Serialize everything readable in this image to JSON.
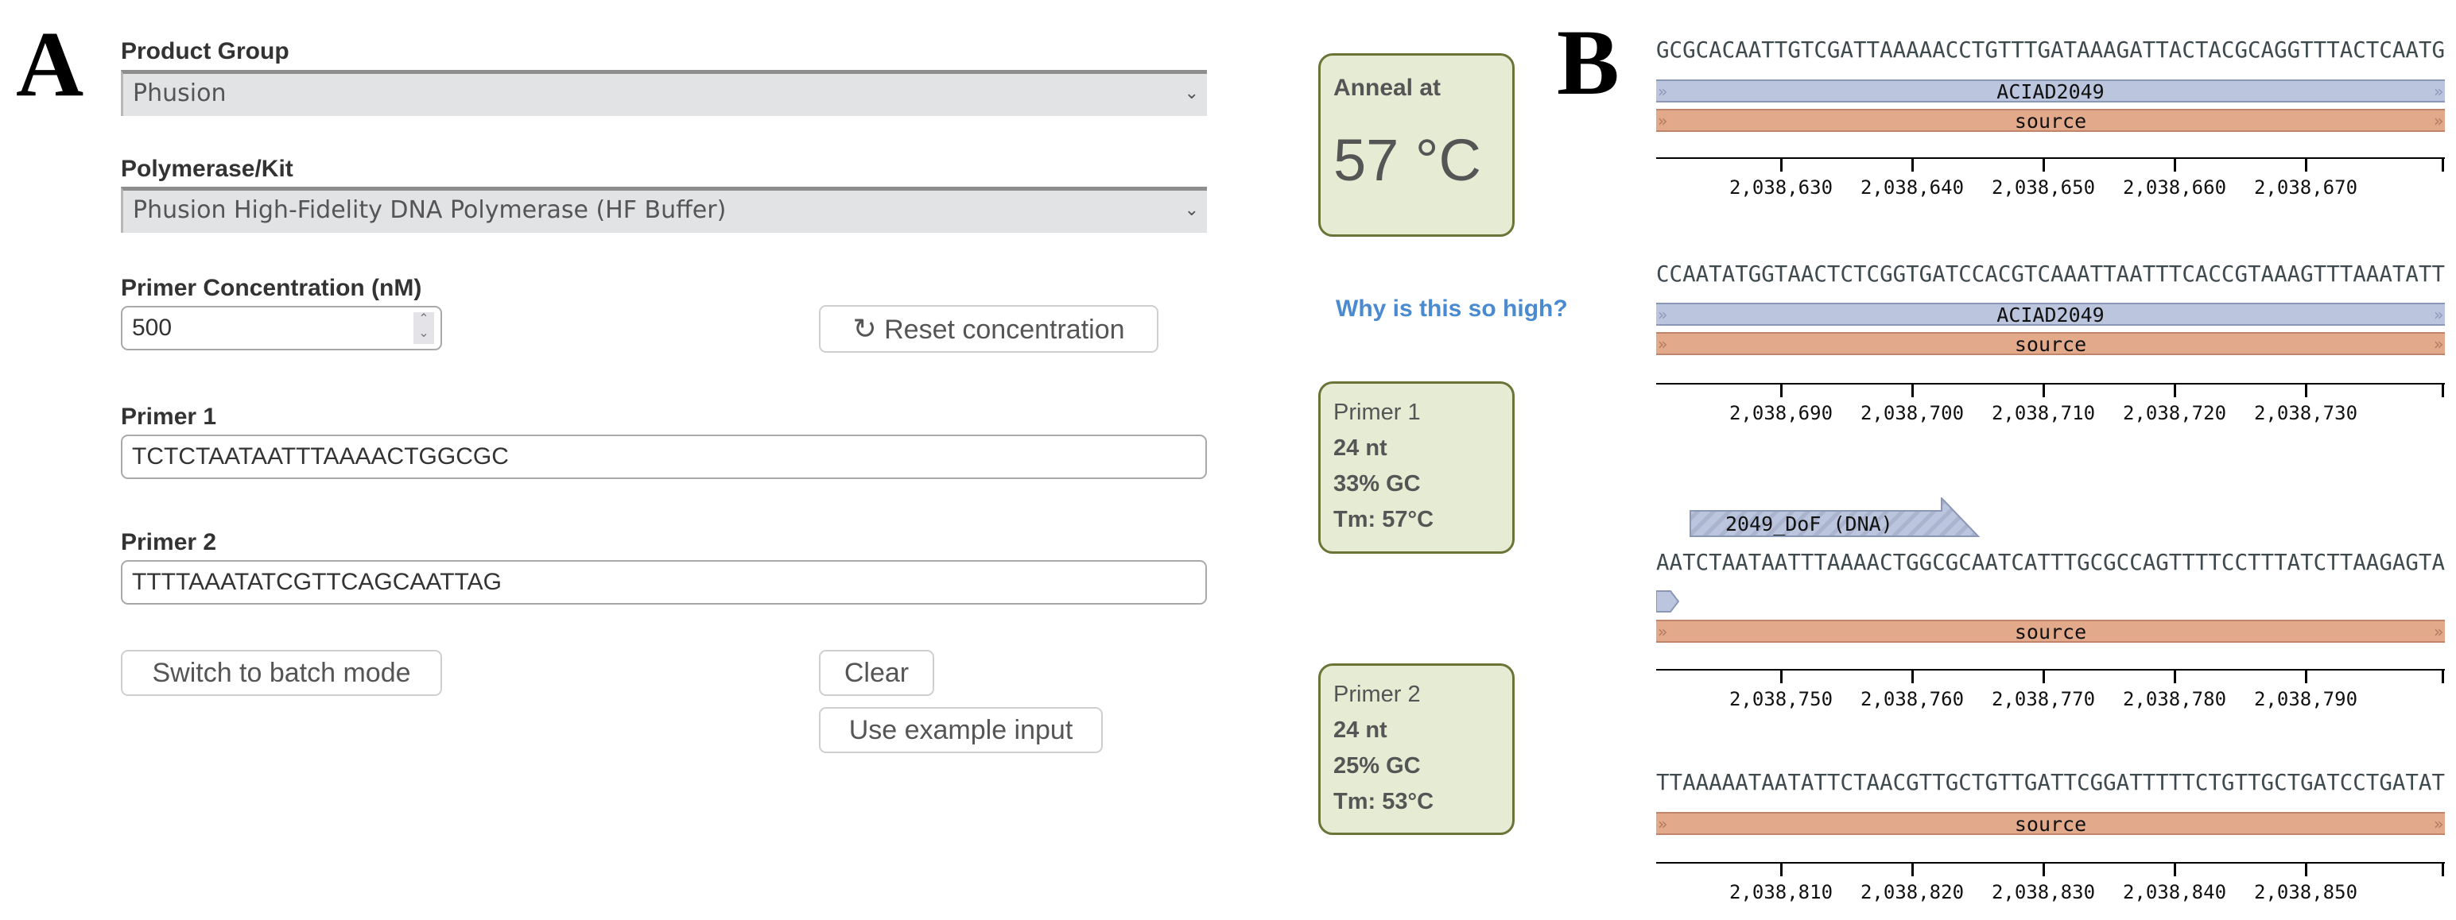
{
  "panel_a": {
    "letter": "A",
    "product_group": {
      "label": "Product Group",
      "value": "Phusion"
    },
    "polymerase": {
      "label": "Polymerase/Kit",
      "value": "Phusion High-Fidelity DNA Polymerase (HF Buffer)"
    },
    "primer_concentration": {
      "label": "Primer Concentration (nM)",
      "value": "500"
    },
    "reset_button": "Reset concentration",
    "primer1": {
      "label": "Primer 1",
      "value": "TCTCTAATAATTTAAAACTGGCGC"
    },
    "primer2": {
      "label": "Primer 2",
      "value": "TTTTAAATATCGTTCAGCAATTAG"
    },
    "batch_button": "Switch to batch mode",
    "clear_button": "Clear",
    "example_button": "Use example input",
    "anneal": {
      "title": "Anneal at",
      "value": "57 °C"
    },
    "why_link": "Why is this so high?",
    "primer1_result": {
      "title": "Primer 1",
      "length": "24 nt",
      "gc": "33% GC",
      "tm": "Tm: 57°C"
    },
    "primer2_result": {
      "title": "Primer 2",
      "length": "24 nt",
      "gc": "25% GC",
      "tm": "Tm: 53°C"
    },
    "colors": {
      "card_bg": "#e6ebd4",
      "card_border": "#6b7436",
      "link": "#4a8ad0"
    }
  },
  "panel_b": {
    "letter": "B",
    "rows": [
      {
        "sequence": "GCGCACAATTGTCGATTAAAAACCTGTTTGATAAAGATTACTACGCAGGTTTACTCAATG",
        "features": [
          {
            "type": "gene",
            "label": "ACIAD2049"
          },
          {
            "type": "source",
            "label": "source"
          }
        ],
        "ticks": [
          "2,038,630",
          "2,038,640",
          "2,038,650",
          "2,038,660",
          "2,038,670"
        ]
      },
      {
        "sequence": "CCAATATGGTAACTCTCGGTGATCCACGTCAAATTAATTTCACCGTAAAGTTTAAATATT",
        "features": [
          {
            "type": "gene",
            "label": "ACIAD2049"
          },
          {
            "type": "source",
            "label": "source"
          }
        ],
        "ticks": [
          "2,038,690",
          "2,038,700",
          "2,038,710",
          "2,038,720",
          "2,038,730"
        ]
      },
      {
        "primer": "2049_DoF (DNA)",
        "sequence": "AATCTAATAATTTAAAACTGGCGCAATCATTTGCGCCAGTTTTCCTTTATCTTAAGAGTA",
        "features": [
          {
            "type": "source",
            "label": "source"
          }
        ],
        "ticks": [
          "2,038,750",
          "2,038,760",
          "2,038,770",
          "2,038,780",
          "2,038,790"
        ]
      },
      {
        "sequence": "TTAAAAATAATATTCTAACGTTGCTGTTGATTCGGATTTTTCTGTTGCTGATCCTGATAT",
        "features": [
          {
            "type": "source",
            "label": "source"
          }
        ],
        "ticks": [
          "2,038,810",
          "2,038,820",
          "2,038,830",
          "2,038,840",
          "2,038,850"
        ]
      }
    ],
    "colors": {
      "gene": "#bcc5de",
      "source": "#e3a98b",
      "primer": "#bcc5de"
    }
  }
}
